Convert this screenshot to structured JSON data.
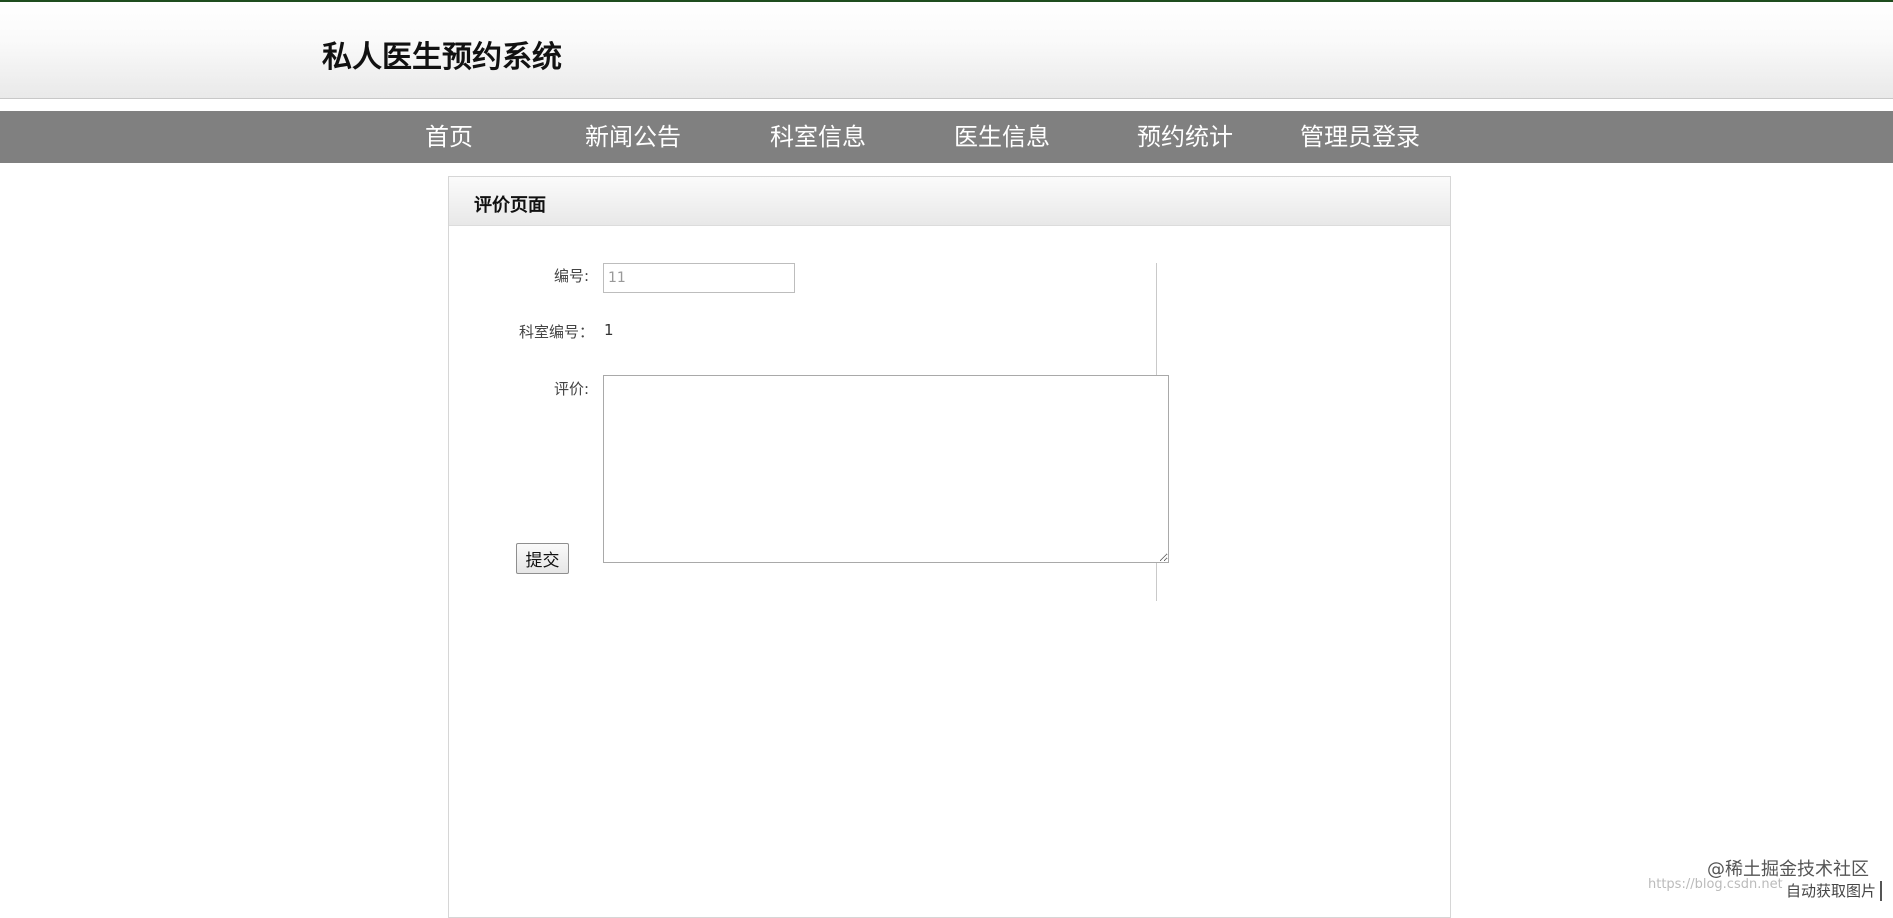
{
  "site": {
    "title": "私人医生预约系统"
  },
  "nav": {
    "items": [
      {
        "label": "首页"
      },
      {
        "label": "新闻公告"
      },
      {
        "label": "科室信息"
      },
      {
        "label": "医生信息"
      },
      {
        "label": "预约统计"
      },
      {
        "label": "管理员登录"
      }
    ]
  },
  "panel": {
    "title": "评价页面"
  },
  "form": {
    "id_label": "编号:",
    "id_value": "11",
    "dept_label": "科室编号：",
    "dept_value": "1",
    "review_label": "评价:",
    "review_value": "",
    "submit_label": "提交"
  },
  "watermark": {
    "text": "@稀土掘金技术社区",
    "url": "https://blog.csdn.net",
    "auto_image_label": "自动获取图片"
  }
}
